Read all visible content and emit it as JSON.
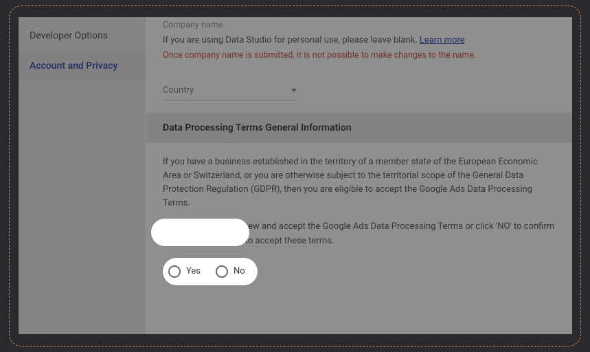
{
  "sidebar": {
    "items": [
      {
        "label": "Developer Options"
      },
      {
        "label": "Account and Privacy"
      }
    ]
  },
  "company": {
    "label": "Company name",
    "helper": "If you are using Data Studio for personal use, please leave blank. ",
    "learn_more": "Learn more",
    "warning": "Once company name is submitted, it is not possible to make changes to the name."
  },
  "country": {
    "label": "Country"
  },
  "terms": {
    "header": "Data Processing Terms General Information",
    "body1": "If you have a business established in the territory of a member state of the European Economic Area or Switzerland, or you are otherwise subject to the territorial scope of the General Data Protection Regulation (GDPR), then you are eligible to accept the Google Ads Data Processing Terms.",
    "body2": "Click 'YES' below to view and accept the Google Ads Data Processing Terms or click 'NO' to confirm that you do not wish to accept these terms.",
    "yes": "Yes",
    "no": "No"
  }
}
